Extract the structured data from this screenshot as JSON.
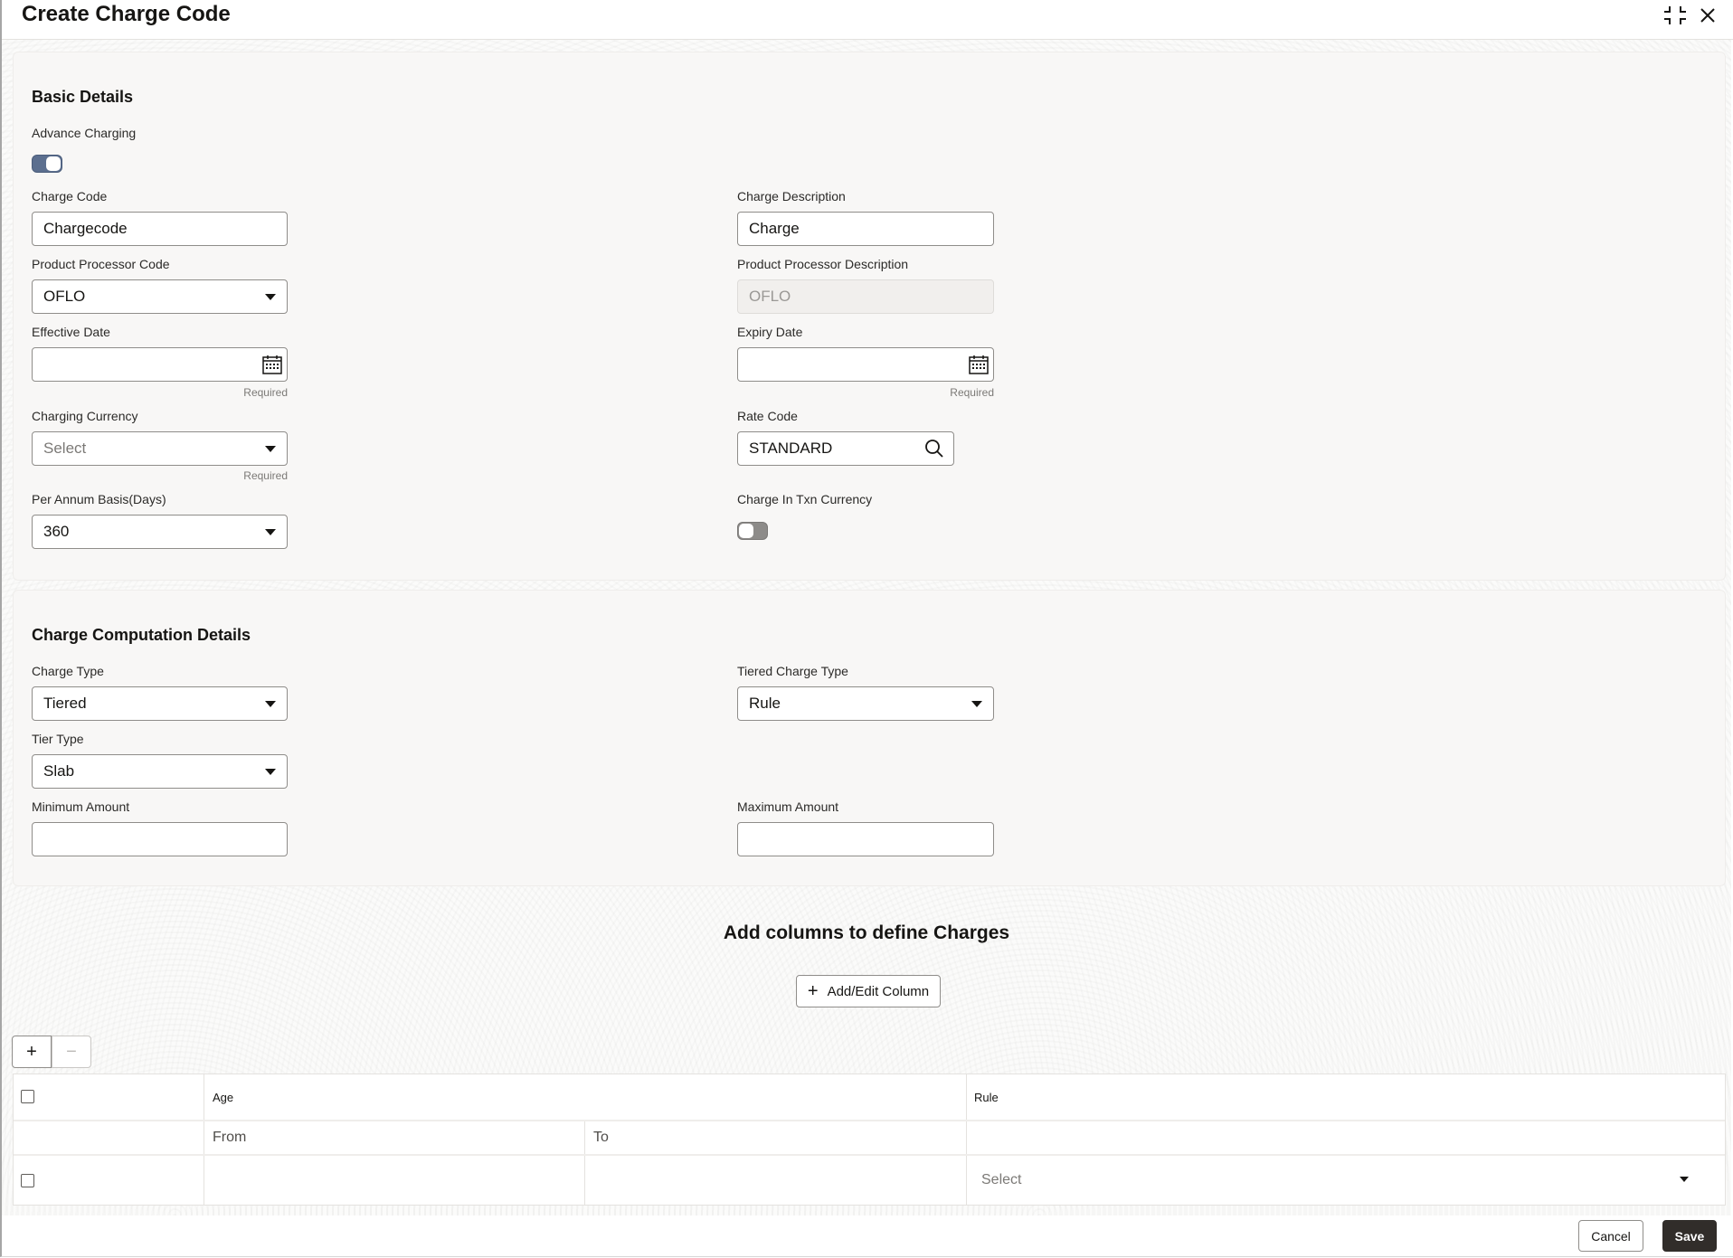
{
  "dialog": {
    "title": "Create Charge Code",
    "icons": {
      "minimize": "collapse-icon",
      "close": "close-icon"
    }
  },
  "basic_details": {
    "title": "Basic Details",
    "advance_charging": {
      "label": "Advance Charging",
      "on": true
    },
    "charge_code": {
      "label": "Charge Code",
      "value": "Chargecode"
    },
    "charge_description": {
      "label": "Charge Description",
      "value": "Charge"
    },
    "product_processor_code": {
      "label": "Product Processor Code",
      "value": "OFLO"
    },
    "product_processor_description": {
      "label": "Product Processor Description",
      "value": "OFLO"
    },
    "effective_date": {
      "label": "Effective Date",
      "value": "",
      "hint": "Required"
    },
    "expiry_date": {
      "label": "Expiry Date",
      "value": "",
      "hint": "Required"
    },
    "charging_currency": {
      "label": "Charging Currency",
      "placeholder": "Select",
      "hint": "Required"
    },
    "rate_code": {
      "label": "Rate Code",
      "value": "STANDARD"
    },
    "per_annum_basis": {
      "label": "Per Annum Basis(Days)",
      "value": "360"
    },
    "charge_in_txn_currency": {
      "label": "Charge In Txn Currency",
      "on": false
    }
  },
  "computation_details": {
    "title": "Charge Computation Details",
    "charge_type": {
      "label": "Charge Type",
      "value": "Tiered"
    },
    "tiered_charge_type": {
      "label": "Tiered Charge Type",
      "value": "Rule"
    },
    "tier_type": {
      "label": "Tier Type",
      "value": "Slab"
    },
    "minimum_amount": {
      "label": "Minimum Amount",
      "value": ""
    },
    "maximum_amount": {
      "label": "Maximum Amount",
      "value": ""
    }
  },
  "columns_section": {
    "title": "Add columns to define Charges",
    "add_edit_label": "Add/Edit Column"
  },
  "table": {
    "add_row": "+",
    "remove_row": "−",
    "headers": {
      "age": "Age",
      "rule": "Rule",
      "from": "From",
      "to": "To"
    },
    "rows": [
      {
        "from": "",
        "to": "",
        "rule_placeholder": "Select"
      }
    ]
  },
  "footer": {
    "cancel": "Cancel",
    "save": "Save"
  }
}
